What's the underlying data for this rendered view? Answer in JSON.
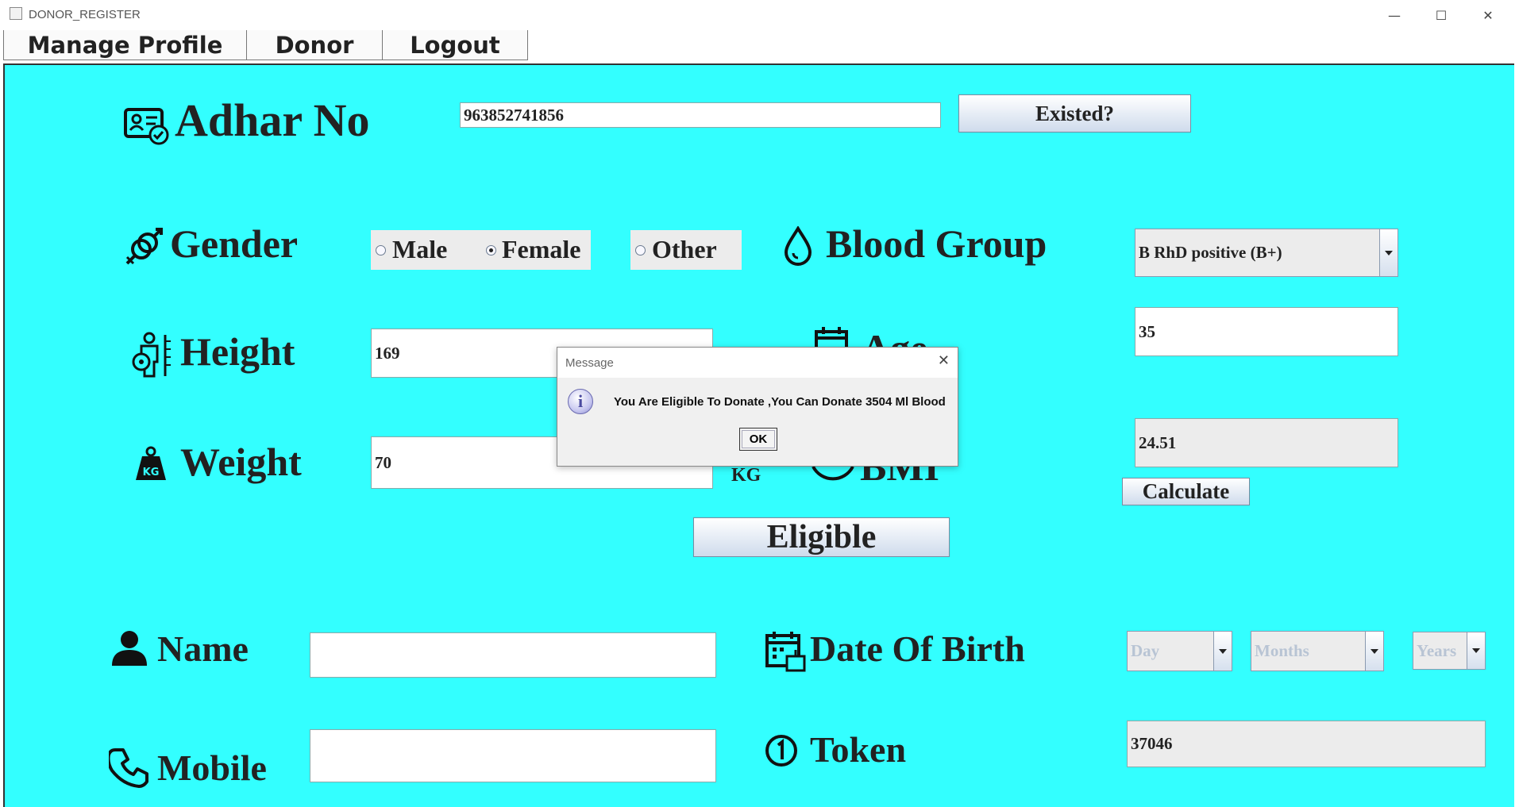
{
  "window": {
    "title": "DONOR_REGISTER",
    "minimize": "—",
    "maximize": "☐",
    "close": "✕"
  },
  "menu": {
    "items": [
      "Manage Profile",
      "Donor",
      "Logout"
    ]
  },
  "form": {
    "adhar": {
      "label": "Adhar No",
      "value": "963852741856",
      "button": "Existed?"
    },
    "gender": {
      "label": "Gender",
      "options": [
        "Male",
        "Female",
        "Other"
      ],
      "selected": "Female"
    },
    "blood_group": {
      "label": "Blood Group",
      "value": "B RhD positive (B+)"
    },
    "height": {
      "label": "Height",
      "value": "169"
    },
    "age": {
      "label": "Age",
      "value": "35"
    },
    "weight": {
      "label": "Weight",
      "value": "70",
      "unit": "KG"
    },
    "bmi": {
      "label": "BMI",
      "value": "24.51",
      "button": "Calculate"
    },
    "eligible_button": "Eligible",
    "name": {
      "label": "Name",
      "value": ""
    },
    "dob": {
      "label": "Date Of Birth",
      "day": "Day",
      "month": "Months",
      "year": "Years"
    },
    "mobile": {
      "label": "Mobile",
      "value": ""
    },
    "token": {
      "label": "Token",
      "value": "37046"
    }
  },
  "dialog": {
    "title": "Message",
    "message": "You Are  Eligible To Donate ,You Can Donate 3504 Ml Blood",
    "ok": "OK",
    "icon": "info-icon"
  },
  "colors": {
    "panel_bg": "#33ffff"
  }
}
